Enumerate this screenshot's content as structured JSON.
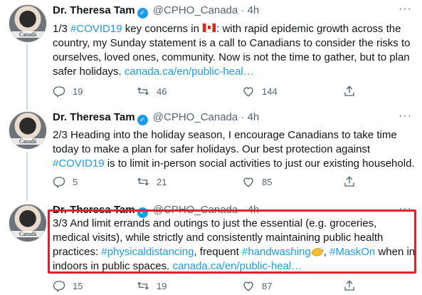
{
  "author": {
    "name": "Dr. Theresa Tam",
    "handle": "@CPHO_Canada",
    "separator": "·",
    "avatar_label": "Canadä",
    "verified_glyph": "✓",
    "more_glyph": "···"
  },
  "tweets": [
    {
      "time": "4h",
      "parts": {
        "p1": "1/3 ",
        "tag1": "#COVID19",
        "p2": " key concerns in ",
        "p3": ": with rapid epidemic growth across the country, my Sunday statement is a call to Canadians to consider the risks to ourselves, loved ones, community. Now is not the time to gather, but to plan safer holidays. ",
        "link": "canada.ca/en/public-heal…"
      },
      "stats": {
        "replies": "19",
        "retweets": "46",
        "likes": "144"
      }
    },
    {
      "time": "4h",
      "parts": {
        "p1": "2/3 Heading into the holiday season, I encourage Canadians to take time today to make a plan for safer holidays. Our best protection against ",
        "tag1": "#COVID19",
        "p2": " is to limit in-person social activities to just our existing household."
      },
      "stats": {
        "replies": "5",
        "retweets": "21",
        "likes": "85"
      }
    },
    {
      "time": "4h",
      "parts": {
        "p1": "3/3 And limit errands and outings to just the essential (e.g. groceries, medical visits), while strictly and consistently maintaining public health practices: ",
        "tag1": "#physicaldistancing",
        "p2": ", frequent ",
        "tag2": "#handwashing",
        "p3": ", ",
        "tag3": "#MaskOn",
        "p4": " when in indoors in public spaces. ",
        "link": "canada.ca/en/public-heal…"
      },
      "stats": {
        "replies": "15",
        "retweets": "19",
        "likes": "87"
      }
    }
  ],
  "colors": {
    "link": "#1d9bf0",
    "highlight_border": "#e0202f",
    "muted": "#536471"
  }
}
